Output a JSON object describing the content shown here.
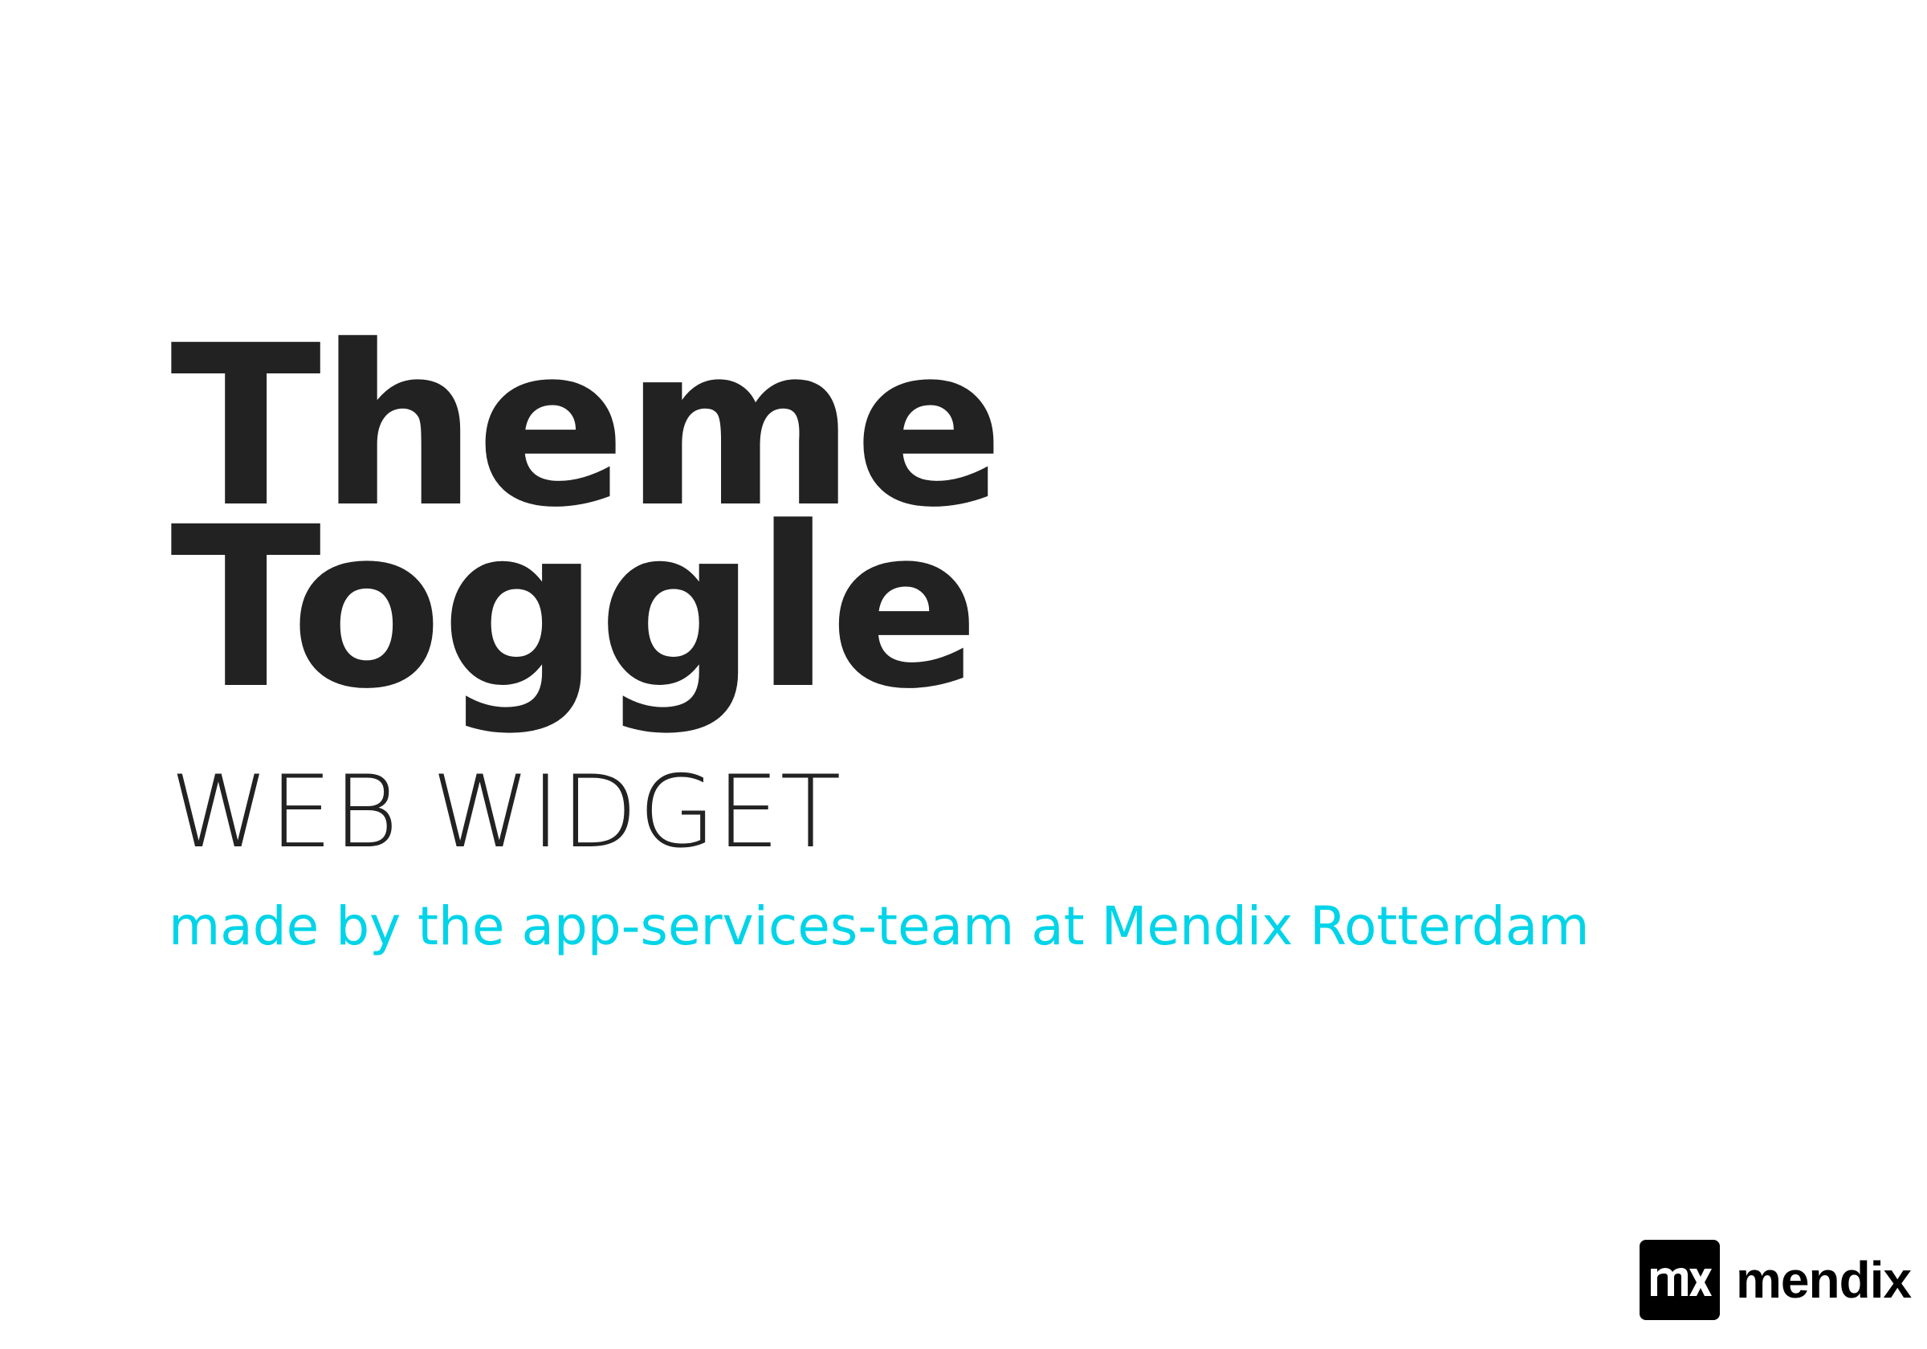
{
  "title": {
    "line1": "Theme",
    "line2": "Toggle"
  },
  "subtitle": "WEB WIDGET",
  "credits": "made by the app-services-team at Mendix Rotterdam",
  "logo": {
    "mark_text": "mx",
    "word": "mendix",
    "color": "#000000"
  },
  "colors": {
    "title": "#222222",
    "accent": "#00d4e8",
    "background": "#ffffff"
  }
}
